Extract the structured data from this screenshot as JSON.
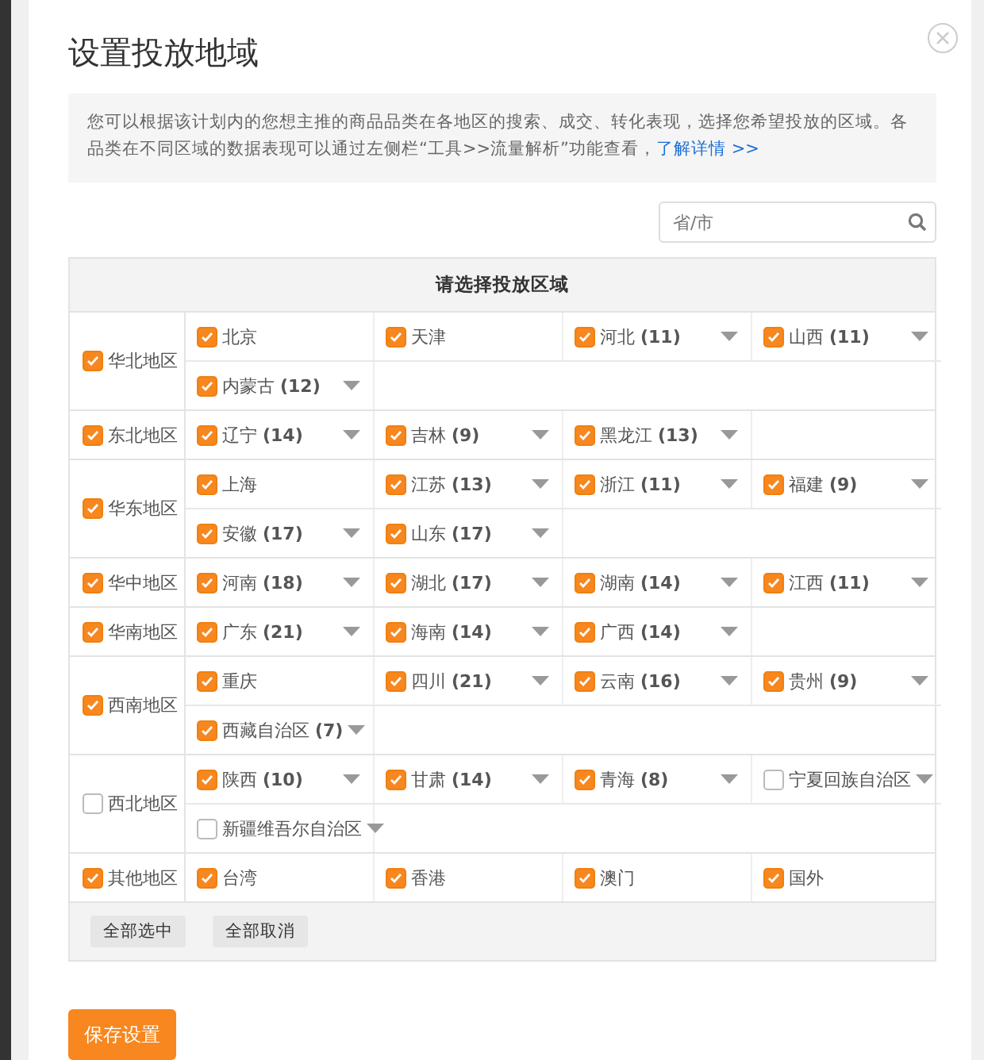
{
  "dialog": {
    "title": "设置投放地域",
    "info": "您可以根据该计划内的您想主推的商品品类在各地区的搜索、成交、转化表现，选择您希望投放的区域。各品类在不同区域的数据表现可以通过左侧栏“工具>>流量解析”功能查看，",
    "info_link": "了解详情 >>"
  },
  "search": {
    "placeholder": "省/市"
  },
  "table": {
    "header": "请选择投放区域",
    "regions": [
      {
        "name": "华北地区",
        "checked": true,
        "provinces": [
          {
            "name": "北京",
            "checked": true,
            "menu": false
          },
          {
            "name": "天津",
            "checked": true,
            "menu": false
          },
          {
            "name": "河北",
            "count": "(11)",
            "checked": true,
            "menu": true
          },
          {
            "name": "山西",
            "count": "(11)",
            "checked": true,
            "menu": true
          },
          {
            "name": "内蒙古",
            "count": "(12)",
            "checked": true,
            "menu": true
          }
        ]
      },
      {
        "name": "东北地区",
        "checked": true,
        "provinces": [
          {
            "name": "辽宁",
            "count": "(14)",
            "checked": true,
            "menu": true
          },
          {
            "name": "吉林",
            "count": "(9)",
            "checked": true,
            "menu": true
          },
          {
            "name": "黑龙江",
            "count": "(13)",
            "checked": true,
            "menu": true
          }
        ]
      },
      {
        "name": "华东地区",
        "checked": true,
        "provinces": [
          {
            "name": "上海",
            "checked": true,
            "menu": false
          },
          {
            "name": "江苏",
            "count": "(13)",
            "checked": true,
            "menu": true
          },
          {
            "name": "浙江",
            "count": "(11)",
            "checked": true,
            "menu": true
          },
          {
            "name": "福建",
            "count": "(9)",
            "checked": true,
            "menu": true
          },
          {
            "name": "安徽",
            "count": "(17)",
            "checked": true,
            "menu": true
          },
          {
            "name": "山东",
            "count": "(17)",
            "checked": true,
            "menu": true
          }
        ]
      },
      {
        "name": "华中地区",
        "checked": true,
        "provinces": [
          {
            "name": "河南",
            "count": "(18)",
            "checked": true,
            "menu": true
          },
          {
            "name": "湖北",
            "count": "(17)",
            "checked": true,
            "menu": true
          },
          {
            "name": "湖南",
            "count": "(14)",
            "checked": true,
            "menu": true
          },
          {
            "name": "江西",
            "count": "(11)",
            "checked": true,
            "menu": true
          }
        ]
      },
      {
        "name": "华南地区",
        "checked": true,
        "provinces": [
          {
            "name": "广东",
            "count": "(21)",
            "checked": true,
            "menu": true
          },
          {
            "name": "海南",
            "count": "(14)",
            "checked": true,
            "menu": true
          },
          {
            "name": "广西",
            "count": "(14)",
            "checked": true,
            "menu": true
          }
        ]
      },
      {
        "name": "西南地区",
        "checked": true,
        "provinces": [
          {
            "name": "重庆",
            "checked": true,
            "menu": false
          },
          {
            "name": "四川",
            "count": "(21)",
            "checked": true,
            "menu": true
          },
          {
            "name": "云南",
            "count": "(16)",
            "checked": true,
            "menu": true
          },
          {
            "name": "贵州",
            "count": "(9)",
            "checked": true,
            "menu": true
          },
          {
            "name": "西藏自治区",
            "count": "(7)",
            "checked": true,
            "menu": true
          }
        ]
      },
      {
        "name": "西北地区",
        "checked": false,
        "provinces": [
          {
            "name": "陕西",
            "count": "(10)",
            "checked": true,
            "menu": true
          },
          {
            "name": "甘肃",
            "count": "(14)",
            "checked": true,
            "menu": true
          },
          {
            "name": "青海",
            "count": "(8)",
            "checked": true,
            "menu": true
          },
          {
            "name": "宁夏回族自治区",
            "checked": false,
            "menu": true
          },
          {
            "name": "新疆维吾尔自治区",
            "checked": false,
            "menu": true
          }
        ]
      },
      {
        "name": "其他地区",
        "checked": true,
        "provinces": [
          {
            "name": "台湾",
            "checked": true,
            "menu": false
          },
          {
            "name": "香港",
            "checked": true,
            "menu": false
          },
          {
            "name": "澳门",
            "checked": true,
            "menu": false
          },
          {
            "name": "国外",
            "checked": true,
            "menu": false
          }
        ]
      }
    ]
  },
  "footer_buttons": [
    "全部选中",
    "全部取消"
  ],
  "save_button": "保存设置"
}
